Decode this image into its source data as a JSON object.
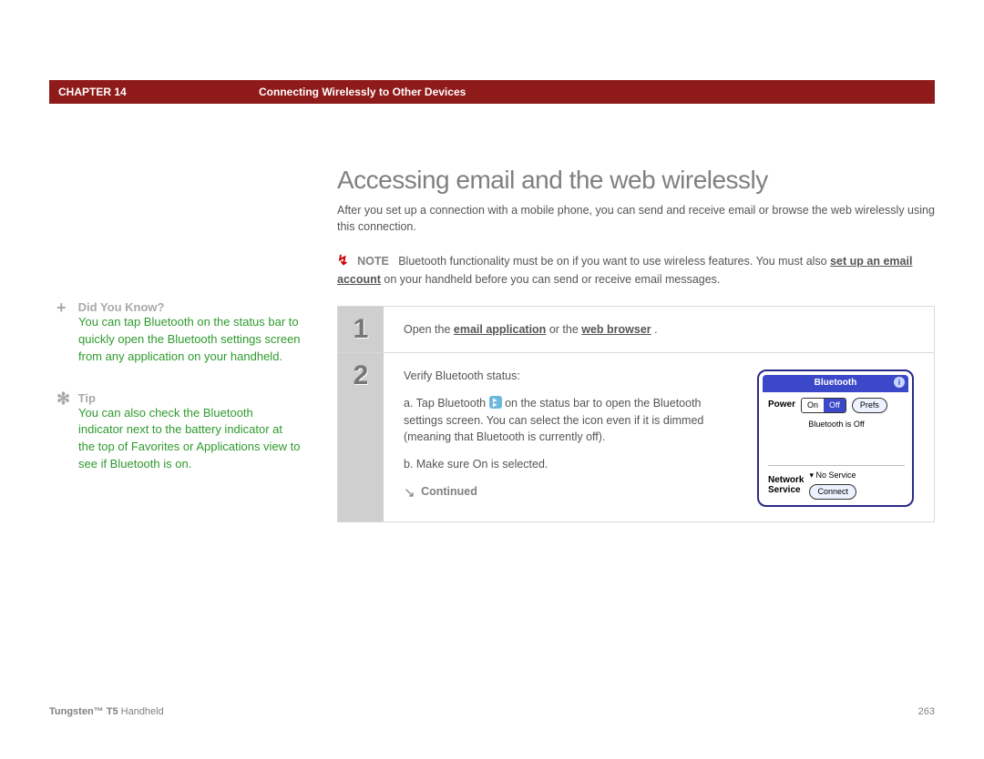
{
  "header": {
    "chapter_label": "CHAPTER 14",
    "section_title": "Connecting Wirelessly to Other Devices"
  },
  "sidebar": {
    "blocks": [
      {
        "icon": "+",
        "title": "Did You Know?",
        "body": "You can tap Bluetooth on the status bar to quickly open the Bluetooth settings screen from any application on your handheld."
      },
      {
        "icon": "✻",
        "title": "Tip",
        "body": "You can also check the Bluetooth indicator next to the battery indicator at the top of Favorites or Applications view to see if Bluetooth is on."
      }
    ]
  },
  "main": {
    "title": "Accessing email and the web wirelessly",
    "intro": "After you set up a connection with a mobile phone, you can send and receive email or browse the web wirelessly using this connection.",
    "note": {
      "label": "NOTE",
      "text_prefix": "Bluetooth functionality must be on if you want to use wireless features. You must also ",
      "link": "set up an email account",
      "text_suffix": " on your handheld before you can send or receive email messages."
    },
    "steps": {
      "step1": {
        "num": "1",
        "text_before": "Open the ",
        "link_a": "email application",
        "text_mid": " or the ",
        "link_b": "web browser",
        "text_after": "."
      },
      "step2": {
        "num": "2",
        "lead": "Verify Bluetooth status:",
        "item_a_prefix": "a.  Tap Bluetooth ",
        "item_a_suffix": " on the status bar to open the Bluetooth settings screen. You can select the icon even if it is dimmed (meaning that Bluetooth is currently off).",
        "item_b": "b.  Make sure On is selected."
      },
      "continued": "Continued"
    }
  },
  "device": {
    "title": "Bluetooth",
    "power_label": "Power",
    "on": "On",
    "off": "Off",
    "prefs": "Prefs",
    "status": "Bluetooth is Off",
    "network_label": "Network",
    "service_label": "Service",
    "service_value": "No Service",
    "connect": "Connect"
  },
  "footer": {
    "product_bold": "Tungsten™ T5",
    "product_rest": " Handheld",
    "page_no": "263"
  }
}
